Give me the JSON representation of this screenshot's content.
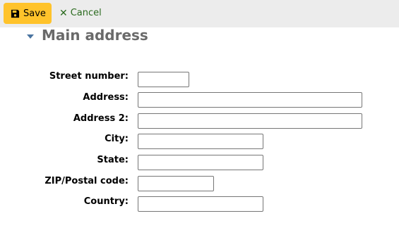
{
  "toolbar": {
    "save_label": "Save",
    "cancel_label": "Cancel"
  },
  "section": {
    "title": "Main address"
  },
  "fields": {
    "street_number": {
      "label": "Street number:",
      "value": ""
    },
    "address": {
      "label": "Address:",
      "value": ""
    },
    "address2": {
      "label": "Address 2:",
      "value": ""
    },
    "city": {
      "label": "City:",
      "value": ""
    },
    "state": {
      "label": "State:",
      "value": ""
    },
    "zip": {
      "label": "ZIP/Postal code:",
      "value": ""
    },
    "country": {
      "label": "Country:",
      "value": ""
    }
  },
  "colors": {
    "save_button": "#ffc32b",
    "cancel_link": "#2a6a1e",
    "caret": "#4a74a0",
    "section_title": "#6a6a6a",
    "toolbar_bg": "#ececec"
  }
}
